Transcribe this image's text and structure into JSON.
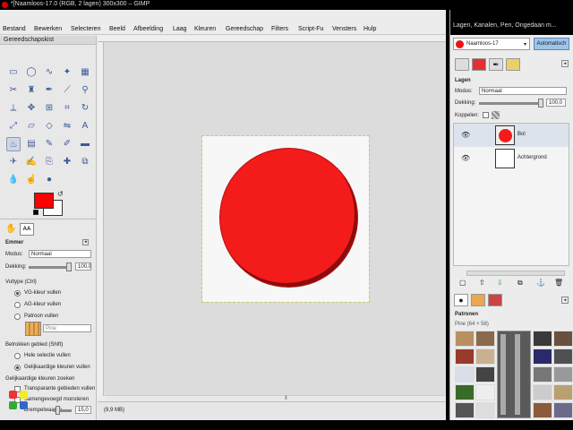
{
  "window": {
    "title": "*[Naamloos-17.0 (RGB, 2 lagen) 300x300 – GIMP",
    "status_text": "(9,9 MB)"
  },
  "menubar": [
    "Bestand",
    "Bewerken",
    "Selecteren",
    "Beeld",
    "Afbeelding",
    "Laag",
    "Kleuren",
    "Gereedschap",
    "Filters",
    "Script-Fu",
    "Vensters",
    "Hulp"
  ],
  "toolbox": {
    "title": "Gereedschapskist",
    "tool_options": {
      "tool_name": "Emmer",
      "mode_label": "Modus:",
      "mode_value": "Normaal",
      "opacity_label": "Dekking:",
      "opacity_value": "100,0",
      "fill_type_label": "Vultype (Ctrl)",
      "fill_types": [
        "VG-kleur vullen",
        "AG-kleur vullen",
        "Patroon vullen"
      ],
      "pattern_name": "Pine",
      "affected_area_label": "Betrokken gebied (Shift)",
      "affected_areas": [
        "Hele selectie vullen",
        "Gelijkaardige kleuren vullen"
      ],
      "similar_colors_label": "Gelijkaardige kleuren zoeken",
      "transparent_label": "Transparante gebieden vullen",
      "merged_label": "Samengevoegd monsteren",
      "threshold_label": "Drempelwaarde",
      "threshold_value": "15,0"
    },
    "colors": {
      "foreground": "#ff0000",
      "background": "#ffffff"
    }
  },
  "dock": {
    "title": "Lagen, Kanalen, Pen, Ongedaan m...",
    "image_selector": "Naamloos-17",
    "auto_button": "Automatisch",
    "layers_tab": "Lagen",
    "mode_label": "Modus:",
    "mode_value": "Normaal",
    "opacity_label": "Dekking:",
    "opacity_value": "100,0",
    "lock_label": "Koppelen:",
    "layers": [
      {
        "name": "Bol",
        "thumb_color": "#f41b1b"
      },
      {
        "name": "Achtergrond",
        "thumb_color": "#ffffff"
      }
    ],
    "patterns_title": "Patronen",
    "patterns_subtitle": "Pine (64 × 58)"
  },
  "canvas": {
    "ball_color": "#f41b1b"
  }
}
